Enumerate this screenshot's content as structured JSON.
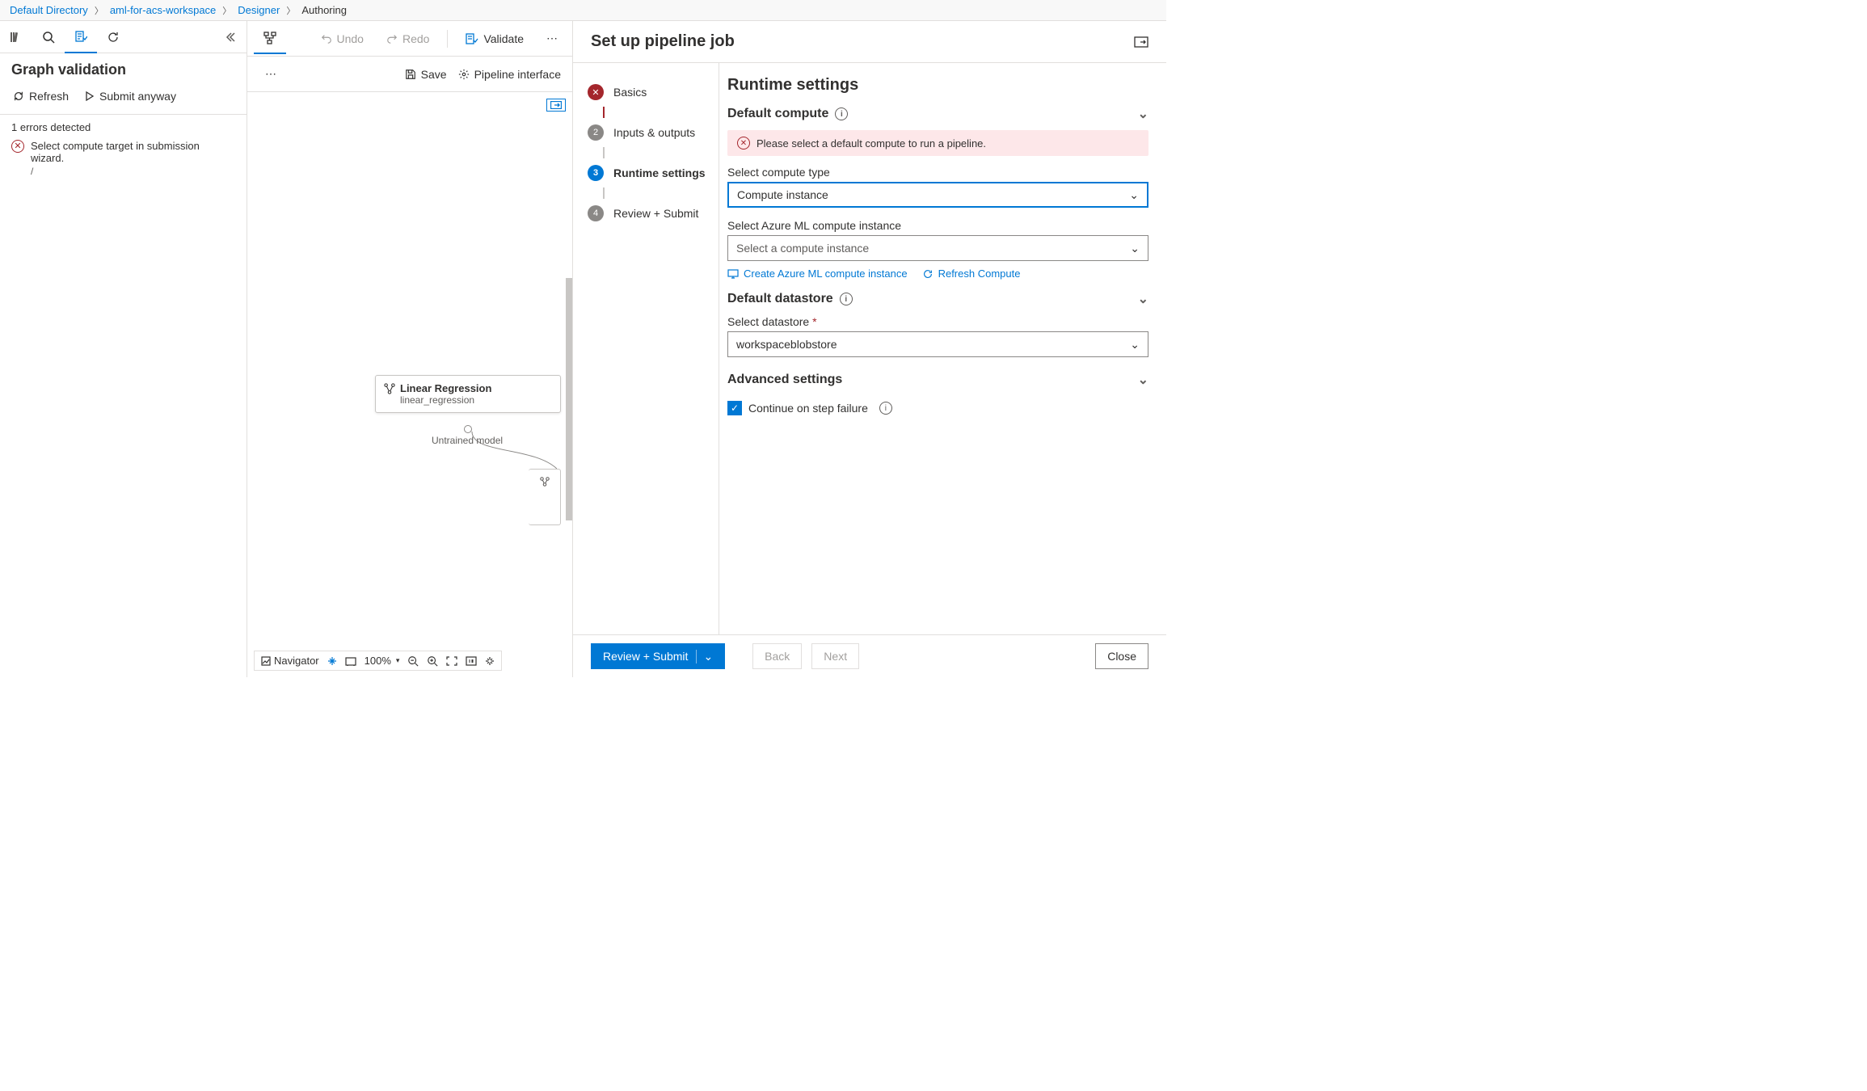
{
  "breadcrumb": {
    "root": "Default Directory",
    "workspace": "aml-for-acs-workspace",
    "section": "Designer",
    "page": "Authoring"
  },
  "leftPanel": {
    "title": "Graph validation",
    "refresh": "Refresh",
    "submit": "Submit anyway",
    "errorCount": "1 errors detected",
    "errorMsg": "Select compute target in submission wizard.",
    "errorPath": "/"
  },
  "toolbar": {
    "undo": "Undo",
    "redo": "Redo",
    "validate": "Validate"
  },
  "canvasSub": {
    "save": "Save",
    "pipelineInterface": "Pipeline interface"
  },
  "canvas": {
    "nodeTitle": "Linear Regression",
    "nodeSub": "linear_regression",
    "portLabel": "Untrained model"
  },
  "navbar": {
    "label": "Navigator",
    "zoom": "100%"
  },
  "wizard": {
    "title": "Set up pipeline job",
    "steps": {
      "s1": "Basics",
      "s2": "Inputs & outputs",
      "s3": "Runtime settings",
      "s4": "Review + Submit"
    },
    "form": {
      "heading": "Runtime settings",
      "defaultCompute": "Default compute",
      "computeError": "Please select a default compute to run a pipeline.",
      "selectTypeLabel": "Select compute type",
      "selectTypeValue": "Compute instance",
      "selectInstanceLabel": "Select Azure ML compute instance",
      "selectInstancePlaceholder": "Select a compute instance",
      "createLink": "Create Azure ML compute instance",
      "refreshLink": "Refresh Compute",
      "defaultDatastore": "Default datastore",
      "selectDatastoreLabel": "Select datastore",
      "selectDatastoreValue": "workspaceblobstore",
      "advanced": "Advanced settings",
      "continueOnFailure": "Continue on step failure"
    },
    "footer": {
      "review": "Review + Submit",
      "back": "Back",
      "next": "Next",
      "close": "Close"
    }
  }
}
